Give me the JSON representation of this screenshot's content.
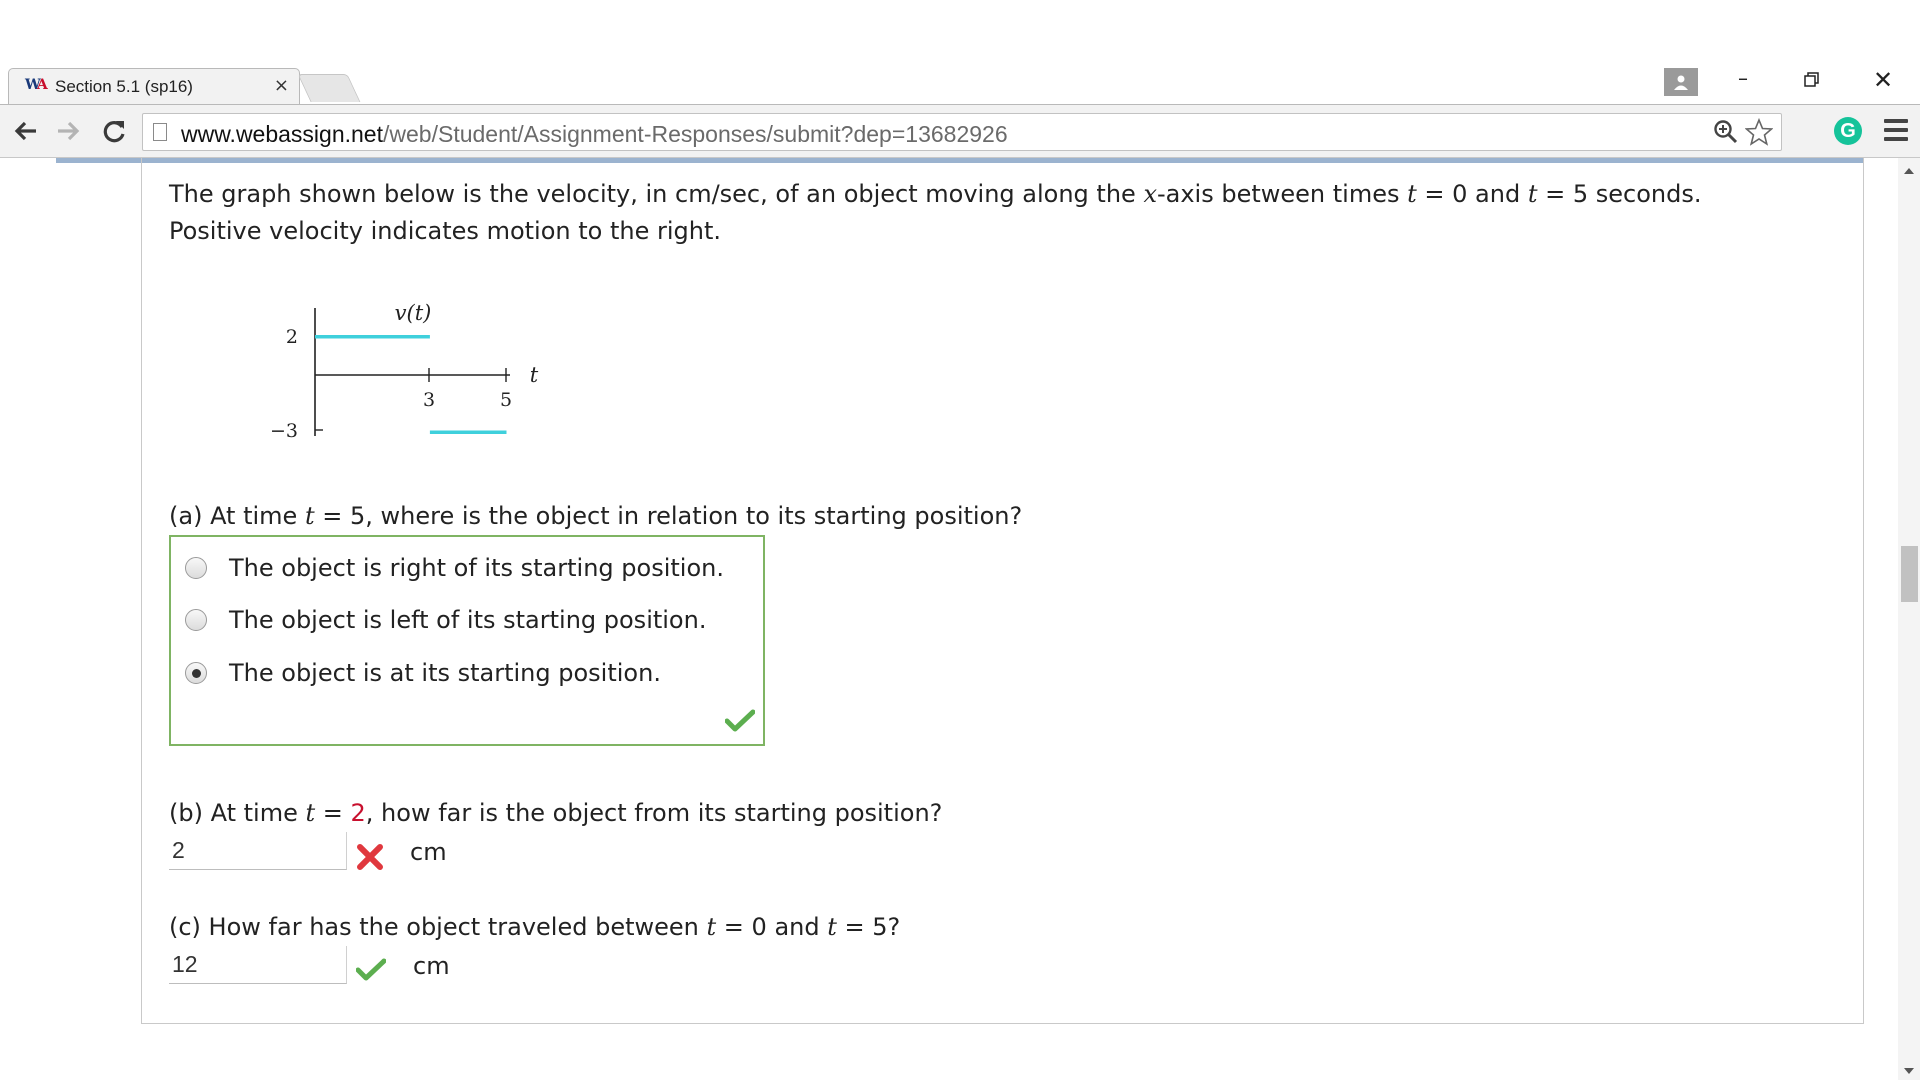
{
  "browser": {
    "tab_title": "Section 5.1 (sp16)",
    "tab_close": "×",
    "favicon_w": "W",
    "favicon_a": "A",
    "url_host": "www.webassign.net",
    "url_path": "/web/Student/Assignment-Responses/submit?dep=13682926",
    "grammarly": "G",
    "icons": [
      "back-arrow-icon",
      "forward-arrow-icon",
      "reload-icon",
      "page-icon",
      "zoom-icon",
      "star-icon",
      "grammarly-icon",
      "menu-icon",
      "profile-icon",
      "minimize-icon",
      "restore-icon",
      "close-icon"
    ]
  },
  "question": {
    "intro": {
      "p1": "The graph shown below is the velocity, in cm/sec, of an object moving along the ",
      "x": "x",
      "p2": "-axis between times ",
      "t1": "t",
      "p3": " = 0 and ",
      "t2": "t",
      "p4": " = 5 seconds.",
      "line2": "Positive velocity indicates motion to the right."
    },
    "graph": {
      "title": "v(t)",
      "xlabel": "t",
      "x_ticks": [
        "3",
        "5"
      ],
      "y_ticks": [
        "2",
        "−3"
      ],
      "line_color": "#3fd0dc",
      "segments": [
        {
          "t_start": 0,
          "t_end": 3,
          "v": 2
        },
        {
          "t_start": 3,
          "t_end": 5,
          "v": -3
        }
      ]
    },
    "part_a": {
      "p1": "(a) At time ",
      "t": "t",
      "p2": " = 5, where is the object in relation to its starting position?",
      "options": [
        {
          "label": "The object is right of its starting position.",
          "selected": false
        },
        {
          "label": "The object is left of its starting position.",
          "selected": false
        },
        {
          "label": "The object is at its starting position.",
          "selected": true
        }
      ],
      "status": "correct"
    },
    "part_b": {
      "p1": "(b) At time ",
      "t": "t",
      "p2": " = ",
      "value": "2",
      "p3": ", how far is the object from its starting position?",
      "answer": "2",
      "unit": "cm",
      "status": "incorrect"
    },
    "part_c": {
      "p1": "(c) How far has the object traveled between ",
      "t1": "t",
      "p2": " = 0 and ",
      "t2": "t",
      "p3": " = 5?",
      "answer": "12",
      "unit": "cm",
      "status": "correct"
    }
  },
  "colors": {
    "correct": "#5cae4f",
    "incorrect": "#e0383e",
    "accent_bar": "#9bb3cf"
  }
}
